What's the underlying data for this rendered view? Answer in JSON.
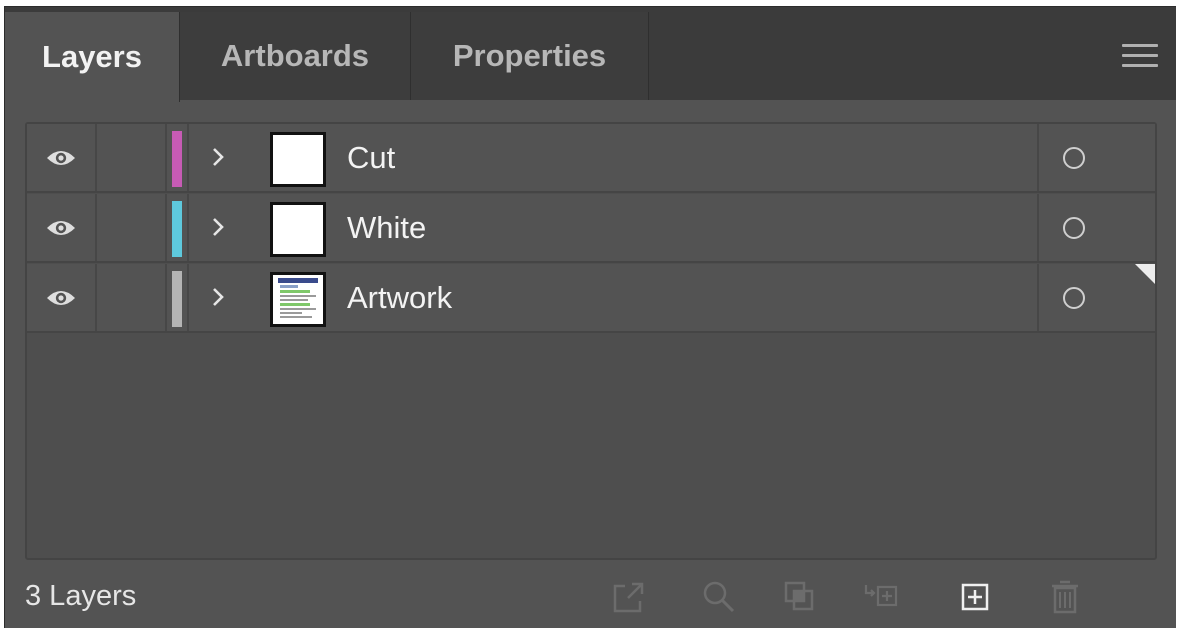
{
  "tabs": [
    {
      "label": "Layers",
      "active": true
    },
    {
      "label": "Artboards",
      "active": false
    },
    {
      "label": "Properties",
      "active": false
    }
  ],
  "layers": [
    {
      "name": "Cut",
      "color": "#c75bb5",
      "visible": true,
      "expanded": false,
      "thumbnail": "blank"
    },
    {
      "name": "White",
      "color": "#5ec9dd",
      "visible": true,
      "expanded": false,
      "thumbnail": "blank"
    },
    {
      "name": "Artwork",
      "color": "#b4b4b4",
      "visible": true,
      "expanded": false,
      "thumbnail": "document",
      "selected_indicator": true
    }
  ],
  "footer": {
    "layer_count": "3 Layers",
    "buttons": [
      {
        "icon": "export-for-screens-icon",
        "enabled": false
      },
      {
        "icon": "locate-object-icon",
        "enabled": false
      },
      {
        "icon": "make-clipping-mask-icon",
        "enabled": false
      },
      {
        "icon": "create-sublayer-icon",
        "enabled": false
      },
      {
        "icon": "create-new-layer-icon",
        "enabled": true
      },
      {
        "icon": "delete-icon",
        "enabled": false
      }
    ]
  },
  "colors": {
    "panel_bg": "#535353",
    "tabbar_bg": "#3b3b3b",
    "text": "#f2f2f2",
    "disabled_icon": "#6c6c6c"
  }
}
